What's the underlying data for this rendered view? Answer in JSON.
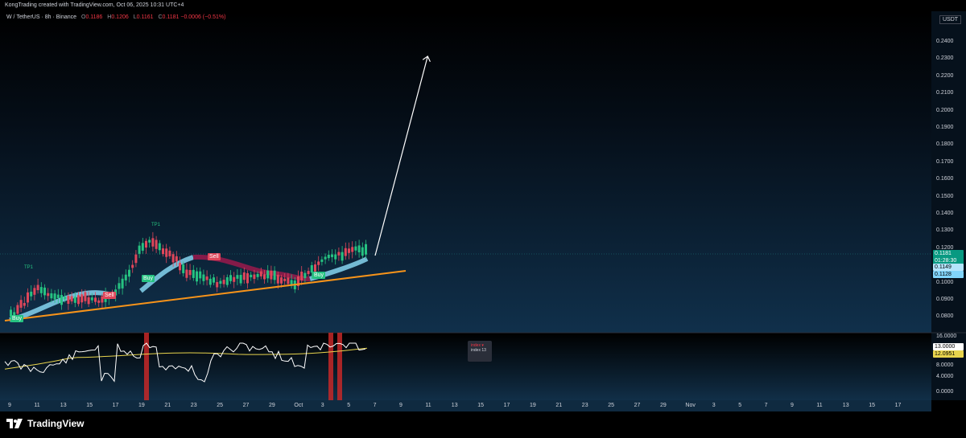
{
  "header": {
    "credit": "KongTrading created with TradingView.com, Oct 06, 2025 10:31 UTC+4"
  },
  "legend": {
    "symbol": "W / TetherUS · 8h · Binance",
    "open_k": "O",
    "open_v": "0.1186",
    "high_k": "H",
    "high_v": "0.1206",
    "low_k": "L",
    "low_v": "0.1161",
    "close_k": "C",
    "close_v": "0.1181 −0.0006 (−0.51%)"
  },
  "price_axis": {
    "currency": "USDT",
    "ticks": [
      "0.2400",
      "0.2300",
      "0.2200",
      "0.2100",
      "0.2000",
      "0.1900",
      "0.1800",
      "0.1700",
      "0.1600",
      "0.1500",
      "0.1400",
      "0.1300",
      "0.1200",
      "0.1100",
      "0.1000",
      "0.0900",
      "0.0800"
    ],
    "last_price": "0.1181",
    "countdown": "01:28:30",
    "level_1": "0.1149",
    "level_2": "0.1128",
    "colors": {
      "last": "#089981",
      "level_1": "#b3e5fc",
      "level_2": "#81d4fa"
    }
  },
  "indicator_axis": {
    "ticks": [
      "16.0000",
      "13.0000",
      "8.0000",
      "4.0000",
      "0.0000"
    ],
    "value_white": "13.0000",
    "value_yellow": "12.0951"
  },
  "time_axis": {
    "labels": [
      "9",
      "11",
      "13",
      "15",
      "17",
      "19",
      "21",
      "23",
      "25",
      "27",
      "29",
      "Oct",
      "3",
      "5",
      "7",
      "9",
      "11",
      "13",
      "15",
      "17",
      "19",
      "21",
      "23",
      "25",
      "27",
      "29",
      "Nov",
      "3",
      "5",
      "7",
      "9",
      "11",
      "13",
      "15",
      "17"
    ]
  },
  "signals": {
    "tp1": "TP1",
    "buy": "Buy",
    "sell": "Sell"
  },
  "tooltip": {
    "title": "index",
    "value": "index 13"
  },
  "footer": {
    "brand": "TradingView"
  },
  "colors": {
    "up": "#26c281",
    "down": "#e0465a",
    "trendline": "#f7931a",
    "band_up": "#7ecbe6",
    "band_down": "#8b1a4a",
    "rsi_line": "#ffffff",
    "rsi_ma": "#e8d44d",
    "highlight": "#c62828"
  }
}
